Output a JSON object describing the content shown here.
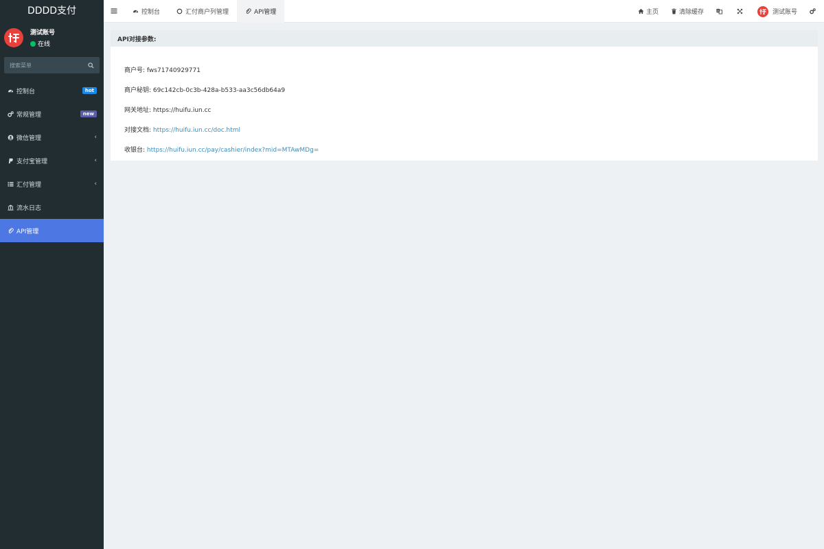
{
  "brand": {
    "title": "DDDD支付"
  },
  "user": {
    "name": "测试账号",
    "status": "在线"
  },
  "search": {
    "placeholder": "搜索菜单"
  },
  "menu": [
    {
      "label": "控制台",
      "icon": "dashboard-icon",
      "badge": "hot",
      "badge_color": "#1a88e6"
    },
    {
      "label": "常规管理",
      "icon": "cogs-icon",
      "badge": "new",
      "badge_color": "#5c5ca8"
    },
    {
      "label": "微信管理",
      "icon": "user-circle-icon",
      "chevron": "‹"
    },
    {
      "label": "支付宝管理",
      "icon": "paypal-icon",
      "chevron": "‹"
    },
    {
      "label": "汇付管理",
      "icon": "list-icon",
      "chevron": "‹"
    },
    {
      "label": "流水日志",
      "icon": "bank-icon"
    },
    {
      "label": "API管理",
      "icon": "paperclip-icon",
      "active": true
    }
  ],
  "tabs": [
    {
      "label": "控制台",
      "icon": "dashboard-icon"
    },
    {
      "label": "汇付商户列管理",
      "icon": "circle-o-icon"
    },
    {
      "label": "API管理",
      "icon": "paperclip-icon",
      "active": true
    }
  ],
  "top_right": {
    "home": "主页",
    "clear_cache": "清除缓存",
    "account": "测试账号"
  },
  "panel": {
    "title": "API对接参数:",
    "rows": [
      {
        "label": "商户号:",
        "value": "fws71740929771",
        "link": false
      },
      {
        "label": "商户秘钥:",
        "value": "69c142cb-0c3b-428a-b533-aa3c56db64a9",
        "link": false
      },
      {
        "label": "网关地址:",
        "value": "https://huifu.iun.cc",
        "link": false
      },
      {
        "label": "对接文档:",
        "value": "https://huifu.iun.cc/doc.html",
        "link": true
      },
      {
        "label": "收银台:",
        "value": "https://huifu.iun.cc/pay/cashier/index?mid=MTAwMDg=",
        "link": true
      }
    ]
  },
  "colors": {
    "sidebar": "#222d32",
    "active": "#4d78e3",
    "link": "#3c8dbc",
    "avatar": "#e8413c"
  }
}
